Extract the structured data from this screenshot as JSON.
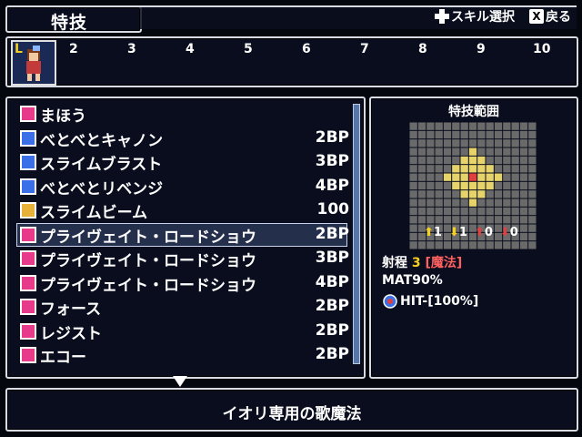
{
  "header": {
    "title": "特技",
    "hint_select": "スキル選択",
    "hint_back": "戻る",
    "x_button": "X"
  },
  "party": {
    "leader_mark": "L",
    "slots": [
      "2",
      "3",
      "4",
      "5",
      "6",
      "7",
      "8",
      "9",
      "10"
    ]
  },
  "skills": [
    {
      "name": "まほう",
      "cost": "",
      "icon": "music-icon",
      "icon_color": "#e83a8a"
    },
    {
      "name": "べとべとキャノン",
      "cost": "2BP",
      "icon": "skill-icon",
      "icon_color": "#3a6fe8"
    },
    {
      "name": "スライムブラスト",
      "cost": "3BP",
      "icon": "skill-icon",
      "icon_color": "#3a6fe8"
    },
    {
      "name": "べとべとリベンジ",
      "cost": "4BP",
      "icon": "skill-icon",
      "icon_color": "#3a6fe8"
    },
    {
      "name": "スライムビーム",
      "cost": "100",
      "icon": "beam-icon",
      "icon_color": "#e8b23a"
    },
    {
      "name": "プライヴェイト・ロードショウ",
      "cost": "2BP",
      "icon": "music-icon",
      "icon_color": "#e83a8a"
    },
    {
      "name": "プライヴェイト・ロードショウ",
      "cost": "3BP",
      "icon": "music-plus1-icon",
      "icon_color": "#e83a8a"
    },
    {
      "name": "プライヴェイト・ロードショウ",
      "cost": "4BP",
      "icon": "music-plus2-icon",
      "icon_color": "#e83a8a"
    },
    {
      "name": "フォース",
      "cost": "2BP",
      "icon": "vo-icon",
      "icon_color": "#e83a8a"
    },
    {
      "name": "レジスト",
      "cost": "2BP",
      "icon": "vo-icon",
      "icon_color": "#e83a8a"
    },
    {
      "name": "エコー",
      "cost": "2BP",
      "icon": "vo-icon",
      "icon_color": "#e83a8a"
    }
  ],
  "selected_index": 5,
  "info": {
    "title": "特技範囲",
    "stat_values": [
      "1",
      "1",
      "0",
      "0"
    ],
    "range_label": "射程",
    "range_value": "3",
    "range_type": "[魔法]",
    "mat": "MAT90%",
    "hit": "HIT-[100%]",
    "colors": {
      "range_yellow": "#e6d36a",
      "center_red": "#e04040",
      "grid_bg": "#6a6a6a"
    }
  },
  "description": "イオリ専用の歌魔法"
}
